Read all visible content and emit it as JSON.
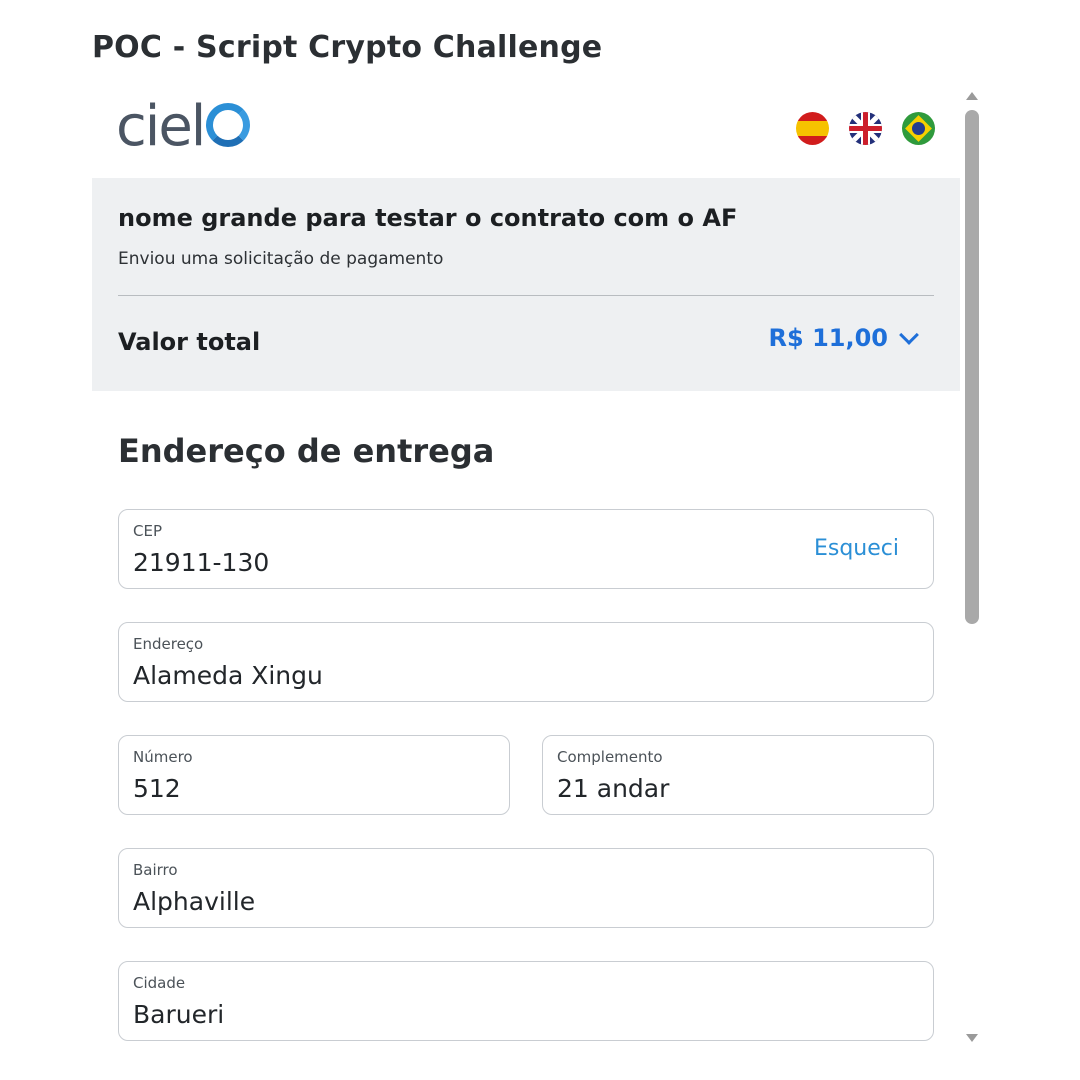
{
  "page_title": "POC - Script Crypto Challenge",
  "brand": {
    "logo_text": "ciel"
  },
  "flags": [
    {
      "name": "spanish-flag-icon"
    },
    {
      "name": "uk-flag-icon"
    },
    {
      "name": "brazil-flag-icon"
    }
  ],
  "summary": {
    "merchant_name": "nome grande para testar o contrato com o AF",
    "subtitle": "Enviou uma solicitação de pagamento",
    "total_label": "Valor total",
    "total_value": "R$ 11,00"
  },
  "section": {
    "title": "Endereço de entrega"
  },
  "fields": {
    "cep": {
      "label": "CEP",
      "value": "21911-130",
      "action": "Esqueci"
    },
    "endereco": {
      "label": "Endereço",
      "value": "Alameda Xingu"
    },
    "numero": {
      "label": "Número",
      "value": "512"
    },
    "complemento": {
      "label": "Complemento",
      "value": "21 andar"
    },
    "bairro": {
      "label": "Bairro",
      "value": "Alphaville"
    },
    "cidade": {
      "label": "Cidade",
      "value": "Barueri"
    }
  },
  "colors": {
    "accent": "#1e6fd9",
    "link": "#2b8fd6",
    "panel": "#eef0f2"
  }
}
